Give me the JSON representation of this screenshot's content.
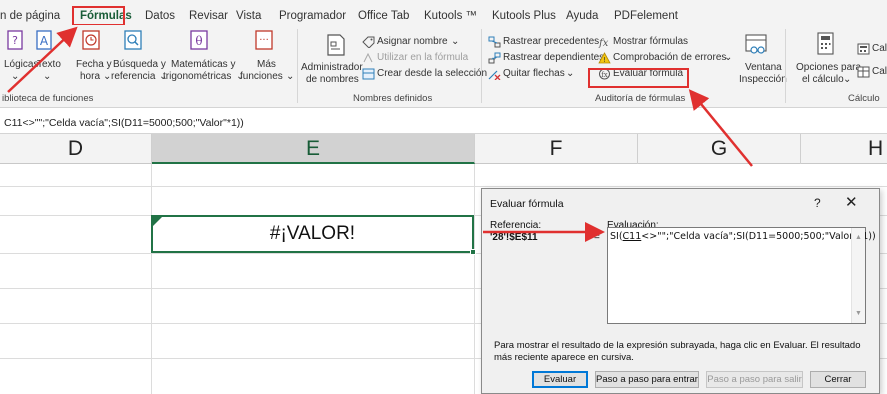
{
  "ribbon_tabs": [
    "n de página",
    "Fórmulas",
    "Datos",
    "Revisar",
    "Vista",
    "Programador",
    "Office Tab",
    "Kutools ™",
    "Kutools Plus",
    "Ayuda",
    "PDFelement"
  ],
  "function_library": {
    "logicas": "Lógicas",
    "texto": "Texto",
    "fecha_1": "Fecha y",
    "fecha_2": "hora",
    "busqueda_1": "Búsqueda y",
    "busqueda_2": "referencia",
    "mat_1": "Matemáticas y",
    "mat_2": "trigonométricas",
    "mas_1": "Más",
    "mas_2": "funciones",
    "group_label": "iblioteca de funciones"
  },
  "defined_names": {
    "admin_1": "Administrador",
    "admin_2": "de nombres",
    "asignar": "Asignar nombre",
    "utilizar": "Utilizar en la fórmula",
    "crear": "Crear desde la selección",
    "group_label": "Nombres definidos"
  },
  "auditing": {
    "precedentes": "Rastrear precedentes",
    "dependientes": "Rastrear dependientes",
    "quitar": "Quitar flechas",
    "mostrar": "Mostrar fórmulas",
    "comprobacion": "Comprobación de errores",
    "evaluar": "Evaluar fórmula",
    "ventana_1": "Ventana",
    "ventana_2": "Inspección",
    "group_label": "Auditoría de fórmulas"
  },
  "calculation": {
    "opciones_1": "Opciones para",
    "opciones_2": "el cálculo",
    "cal_1": "Cal",
    "cal_2": "Cal",
    "group_label": "Cálculo"
  },
  "formula_bar": "C11<>\"\";\"Celda vacía\";SI(D11=5000;500;\"Valor\"*1))",
  "columns": [
    "D",
    "E",
    "F",
    "G",
    "H"
  ],
  "selected_column": "E",
  "active_cell_value": "#¡VALOR!",
  "dialog": {
    "title": "Evaluar fórmula",
    "help": "?",
    "close": "✕",
    "ref_label": "Referencia:",
    "eval_label": "Evaluación:",
    "ref_value": "'28'!$E$11",
    "equals": "=",
    "eval_pre": "SI(",
    "eval_underlined": "C11",
    "eval_post": "<>\"\";\"Celda vacía\";SI(D11=5000;500;\"Valor\"*1))",
    "hint": "Para mostrar el resultado de la expresión subrayada, haga clic en Evaluar. El resultado más reciente aparece en cursiva.",
    "buttons": {
      "evaluar": "Evaluar",
      "paso_entrar": "Paso a paso para entrar",
      "paso_salir": "Paso a paso para salir",
      "cerrar": "Cerrar"
    }
  },
  "colors": {
    "accent": "#217346",
    "highlight": "#e0302f",
    "dialog_focus": "#0078d7"
  }
}
